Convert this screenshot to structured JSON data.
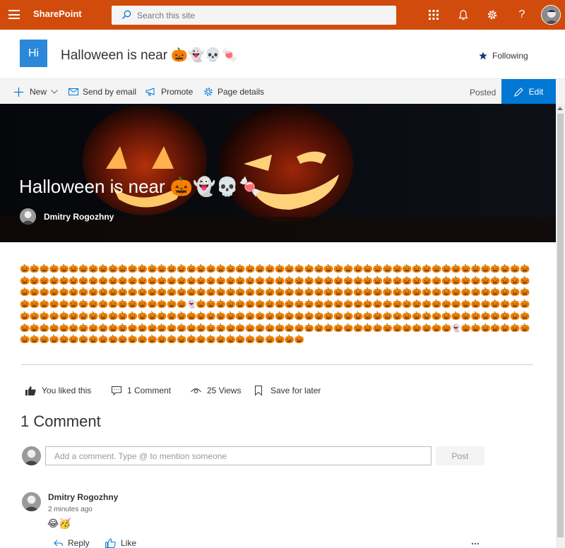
{
  "suite_bar": {
    "brand": "SharePoint",
    "search_placeholder": "Search this site"
  },
  "site": {
    "logo_text": "Hi",
    "title": "Halloween is near 🎃👻💀🍬",
    "following_label": "Following"
  },
  "command_bar": {
    "new_label": "New",
    "send_by_email_label": "Send by email",
    "promote_label": "Promote",
    "page_details_label": "Page details",
    "status_label": "Posted",
    "edit_label": "Edit"
  },
  "hero": {
    "title": "Halloween is near 🎃👻💀🍬",
    "author": "Dmitry Rogozhny"
  },
  "content": {
    "pumpkin_text": "🎃🎃🎃🎃🎃🎃🎃🎃🎃🎃🎃🎃🎃🎃🎃🎃🎃🎃🎃🎃🎃🎃🎃🎃🎃🎃🎃🎃🎃🎃🎃🎃🎃🎃🎃🎃🎃🎃🎃🎃🎃🎃🎃🎃🎃🎃🎃🎃🎃🎃🎃🎃🎃🎃🎃🎃🎃🎃🎃🎃🎃🎃🎃🎃🎃🎃🎃🎃🎃🎃🎃🎃🎃🎃🎃🎃🎃🎃🎃🎃🎃🎃🎃🎃🎃🎃🎃🎃🎃🎃🎃🎃🎃🎃🎃🎃🎃🎃🎃🎃🎃🎃🎃🎃🎃🎃🎃🎃🎃🎃🎃🎃🎃🎃🎃🎃🎃🎃🎃🎃🎃🎃🎃🎃🎃🎃🎃🎃🎃🎃🎃🎃🎃🎃🎃🎃🎃🎃🎃🎃🎃🎃🎃🎃🎃🎃🎃🎃🎃🎃🎃🎃🎃🎃🎃🎃🎃🎃🎃🎃🎃🎃🎃🎃🎃🎃🎃🎃🎃🎃🎃🎃🎃👻🎃🎃🎃🎃🎃🎃🎃🎃🎃🎃🎃🎃🎃🎃🎃🎃🎃🎃🎃🎃🎃🎃🎃🎃🎃🎃🎃🎃🎃🎃🎃🎃🎃🎃🎃🎃🎃🎃🎃🎃🎃🎃🎃🎃🎃🎃🎃🎃🎃🎃🎃🎃🎃🎃🎃🎃🎃🎃🎃🎃🎃🎃🎃🎃🎃🎃🎃🎃🎃🎃🎃🎃🎃🎃🎃🎃🎃🎃🎃🎃🎃🎃🎃🎃🎃🎃🎃🎃🎃🎃🎃🎃🎃🎃🎃🎃🎃🎃🎃🎃🎃🎃🎃🎃🎃🎃🎃🎃🎃🎃🎃🎃🎃🎃🎃🎃🎃🎃🎃🎃🎃🎃🎃🎃🎃🎃🎃🎃🎃🎃👻🎃🎃🎃🎃🎃🎃🎃🎃🎃🎃🎃🎃🎃🎃🎃🎃🎃🎃🎃🎃🎃🎃🎃🎃🎃🎃🎃🎃🎃🎃🎃🎃🎃🎃🎃🎃"
  },
  "social_bar": {
    "like_label": "You liked this",
    "comments_label": "1 Comment",
    "views_label": "25 Views",
    "save_label": "Save for later"
  },
  "comments": {
    "heading": "1 Comment",
    "input_placeholder": "Add a comment. Type @ to mention someone",
    "post_label": "Post",
    "items": [
      {
        "author": "Dmitry Rogozhny",
        "time": "2 minutes ago",
        "text": "😂🥳",
        "reply_label": "Reply",
        "like_label": "Like",
        "more_label": "..."
      }
    ]
  },
  "colors": {
    "suite_bar": "#d14c0c",
    "accent": "#0078d4",
    "site_logo": "#2b88d8"
  }
}
